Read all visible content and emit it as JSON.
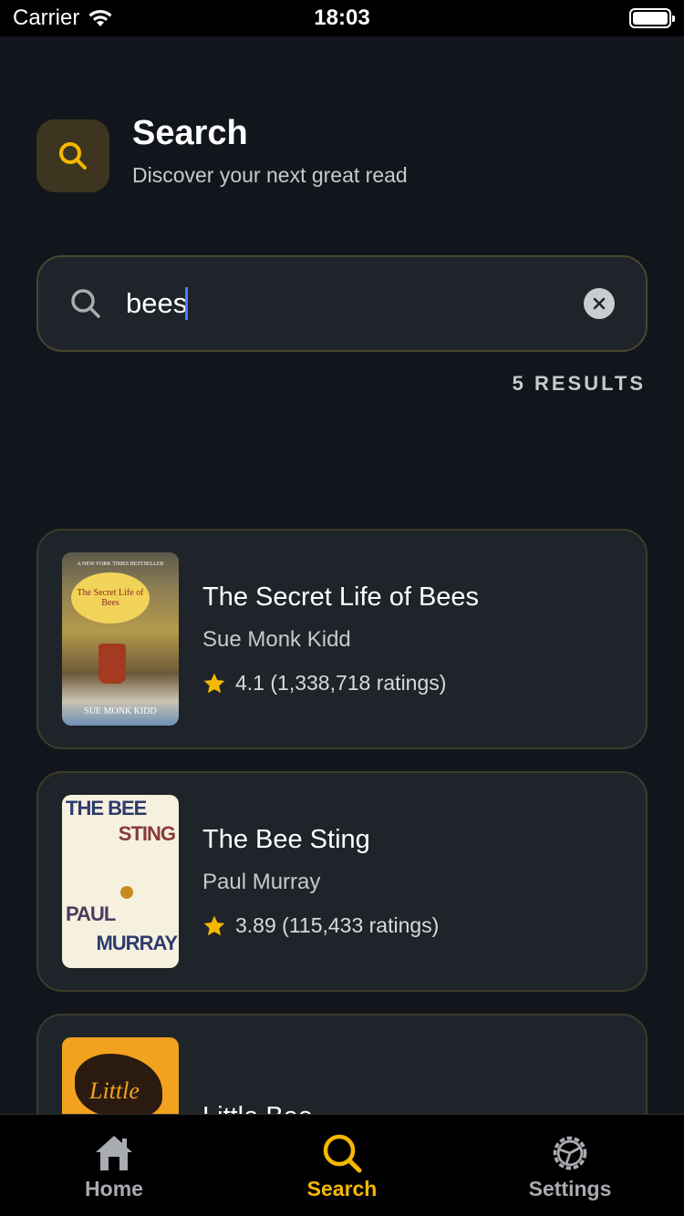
{
  "status_bar": {
    "carrier": "Carrier",
    "time": "18:03"
  },
  "header": {
    "title": "Search",
    "subtitle": "Discover your next great read",
    "icon": "search-icon"
  },
  "search": {
    "value": "bees",
    "clear_icon": "close-icon"
  },
  "results": {
    "count_label": "5 RESULTS"
  },
  "books": [
    {
      "title": "The Secret Life of Bees",
      "author": "Sue Monk Kidd",
      "rating": "4.1 (1,338,718 ratings)",
      "cover": {
        "top_text": "A NEW YORK TIMES BESTSELLER",
        "title_text": "The Secret Life of Bees",
        "author_text": "SUE MONK KIDD"
      }
    },
    {
      "title": "The Bee Sting",
      "author": "Paul Murray",
      "rating": "3.89 (115,433 ratings)",
      "cover": {
        "line1": "THE BEE",
        "line2": "STING",
        "line3": "PAUL",
        "line4": "MURRAY"
      }
    },
    {
      "title": "Little Bee",
      "author": "",
      "rating": "",
      "cover": {
        "title_text": "Little"
      }
    }
  ],
  "tabs": [
    {
      "label": "Home",
      "icon": "home-icon",
      "active": false
    },
    {
      "label": "Search",
      "icon": "search-icon",
      "active": true
    },
    {
      "label": "Settings",
      "icon": "gear-icon",
      "active": false
    }
  ],
  "colors": {
    "accent": "#f5b800",
    "inactive": "#a8abb0",
    "background": "#12161c",
    "card": "#1f242a"
  }
}
